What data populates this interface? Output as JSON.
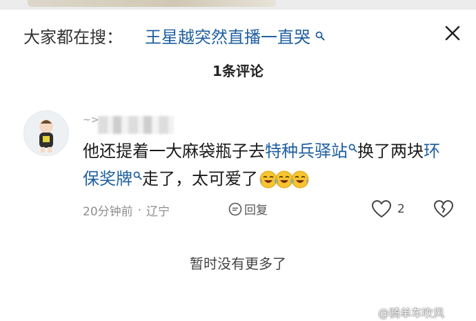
{
  "header": {
    "search_label": "大家都在搜：",
    "search_term": "王星越突然直播一直哭",
    "search_icon": "magnifier-icon",
    "close_icon": "close-icon"
  },
  "comment_count": "1条评论",
  "comment": {
    "username_prefix": "~>",
    "text_1": "他还提着一大麻袋瓶子去",
    "link_1": "特种兵驿站",
    "text_2": "换了两块",
    "link_2": "环保奖牌",
    "text_3": "走了，太可爱了",
    "emoji": "laughing-crying-face",
    "emoji_count": 3,
    "time": "20分钟前",
    "location": "辽宁",
    "reply_label": "回复",
    "like_count": "2"
  },
  "footer": {
    "no_more": "暂时没有更多了",
    "watermark": "@骑单车吹风"
  },
  "colors": {
    "link": "#1f5fa0",
    "meta": "#8e8e8e"
  }
}
